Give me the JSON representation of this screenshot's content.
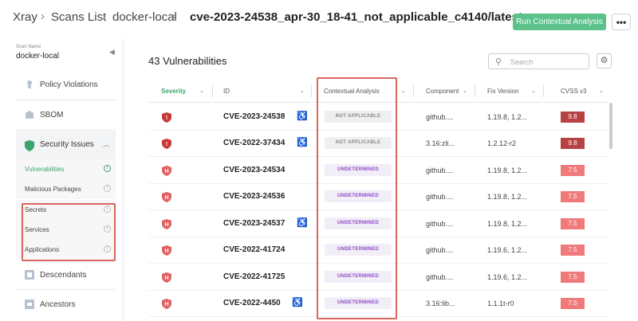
{
  "header": {
    "breadcrumbs": [
      "Xray",
      "Scans List",
      "docker-local"
    ],
    "current": "cve-2023-24538_apr-30_18-41_not_applicable_c4140/latest",
    "run_button": "Run Contextual Analysis",
    "more_button": "•••"
  },
  "sidebar": {
    "scan_name_label": "Scan Name",
    "scan_name": "docker-local",
    "items": [
      {
        "label": "Policy Violations",
        "icon": "person-alert-icon"
      },
      {
        "label": "SBOM",
        "icon": "puzzle-icon"
      }
    ],
    "security_group": {
      "label": "Security Issues",
      "icon": "shield-icon",
      "subitems": [
        {
          "label": "Vulnerabilities",
          "active": true
        },
        {
          "label": "Malicious Packages",
          "active": false
        },
        {
          "label": "Secrets",
          "active": false
        },
        {
          "label": "Services",
          "active": false
        },
        {
          "label": "Applications",
          "active": false
        }
      ]
    },
    "bottom_items": [
      {
        "label": "Descendants",
        "icon": "descendants-icon"
      },
      {
        "label": "Ancestors",
        "icon": "ancestors-icon"
      }
    ]
  },
  "main": {
    "title": "43 Vulnerabilities",
    "search_placeholder": "Search",
    "columns": [
      "Severity",
      "ID",
      "Contextual Analysis",
      "Component",
      "Fix Version",
      "CVSS v3"
    ],
    "rows": [
      {
        "severity": "critical",
        "id": "CVE-2023-24538",
        "has_fix_icon": true,
        "ca": "NOT APPLICABLE",
        "component": "github....",
        "fix": "1.19.8, 1.2...",
        "cvss": "9.8"
      },
      {
        "severity": "critical",
        "id": "CVE-2022-37434",
        "has_fix_icon": true,
        "ca": "NOT APPLICABLE",
        "component": "3.16:zli...",
        "fix": "1.2.12-r2",
        "cvss": "9.8"
      },
      {
        "severity": "high",
        "id": "CVE-2023-24534",
        "has_fix_icon": false,
        "ca": "UNDETERMINED",
        "component": "github....",
        "fix": "1.19.8, 1.2...",
        "cvss": "7.5"
      },
      {
        "severity": "high",
        "id": "CVE-2023-24536",
        "has_fix_icon": false,
        "ca": "UNDETERMINED",
        "component": "github....",
        "fix": "1.19.8, 1.2...",
        "cvss": "7.5"
      },
      {
        "severity": "high",
        "id": "CVE-2023-24537",
        "has_fix_icon": true,
        "ca": "UNDETERMINED",
        "component": "github....",
        "fix": "1.19.8, 1.2...",
        "cvss": "7.5"
      },
      {
        "severity": "high",
        "id": "CVE-2022-41724",
        "has_fix_icon": false,
        "ca": "UNDETERMINED",
        "component": "github....",
        "fix": "1.19.6, 1.2...",
        "cvss": "7.5"
      },
      {
        "severity": "high",
        "id": "CVE-2022-41725",
        "has_fix_icon": false,
        "ca": "UNDETERMINED",
        "component": "github....",
        "fix": "1.19.6, 1.2...",
        "cvss": "7.5"
      },
      {
        "severity": "high",
        "id": "CVE-2022-4450",
        "has_fix_icon": true,
        "ca": "UNDETERMINED",
        "component": "3.16:lib...",
        "fix": "1.1.1t-r0",
        "cvss": "7.5"
      }
    ]
  },
  "colors": {
    "accent_green": "#5cc18a",
    "critical": "#b84242",
    "high": "#f07a7a",
    "undetermined_text": "#8d47c9",
    "highlight": "#d9665c"
  }
}
